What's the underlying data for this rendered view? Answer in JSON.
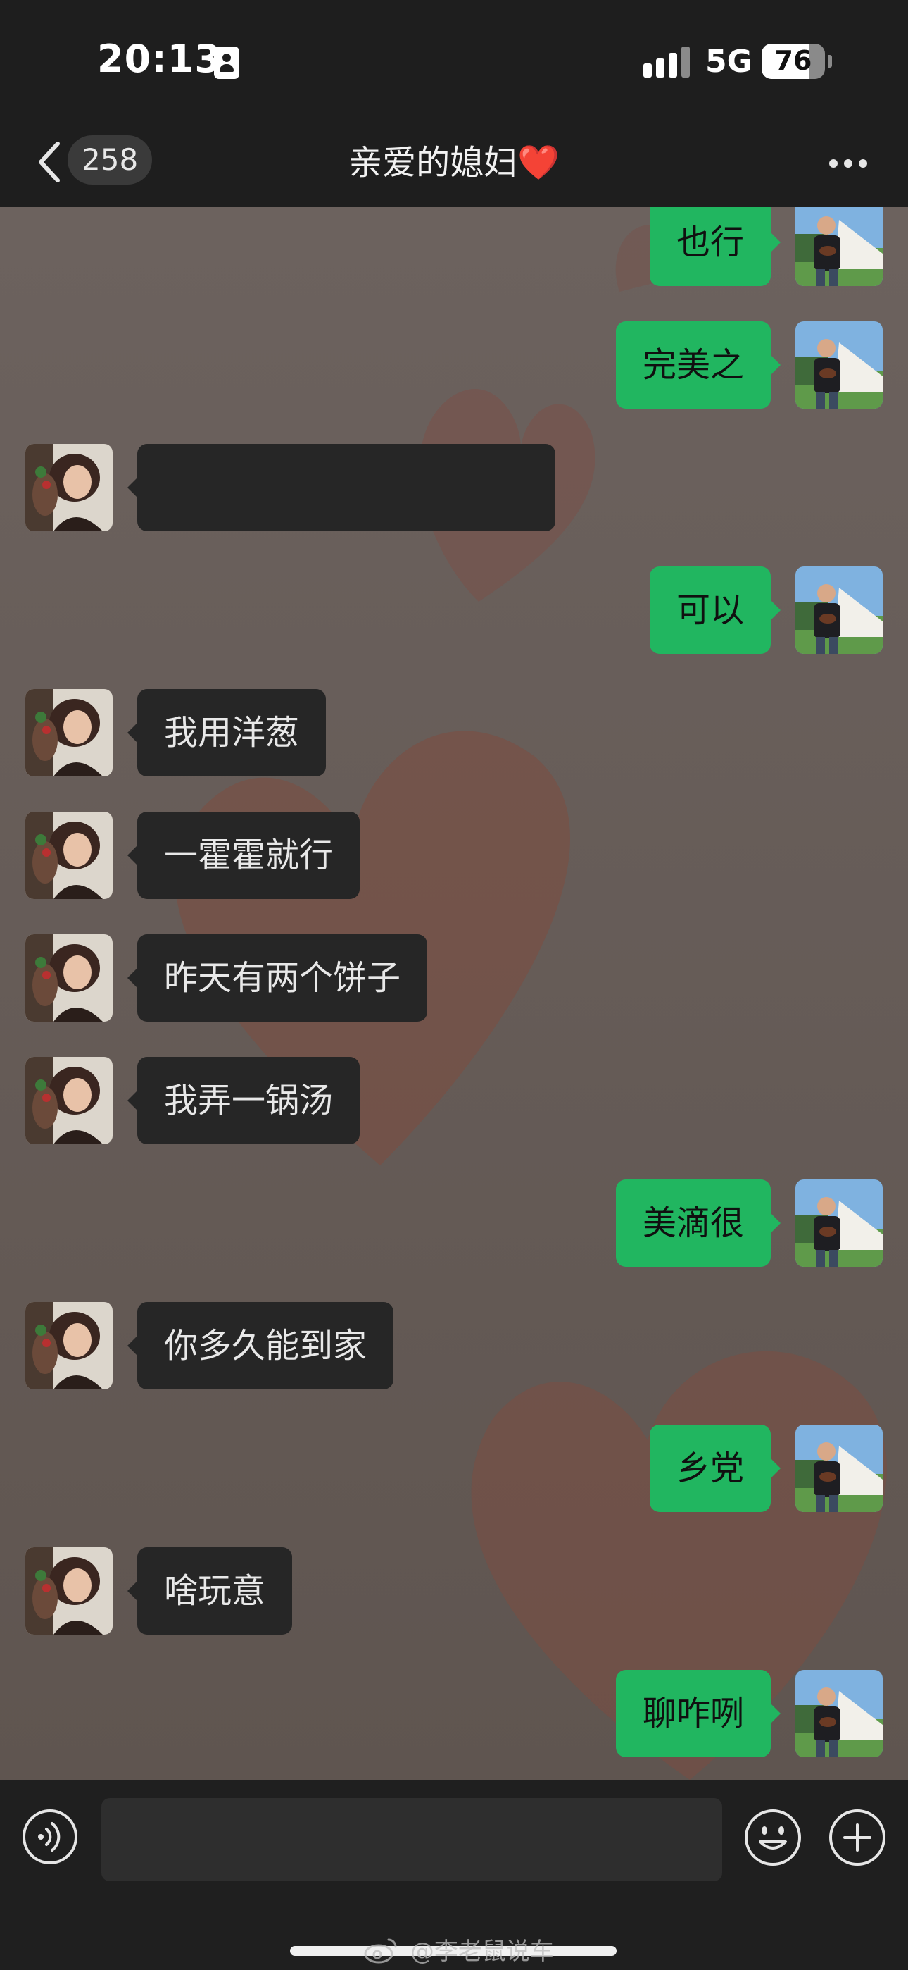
{
  "status_bar": {
    "time": "20:13",
    "network": "5G",
    "battery_level": 76,
    "battery_text": "76",
    "focus_icon": "person-badge-icon",
    "signal_icon": "cellular-signal-icon"
  },
  "nav": {
    "back_icon": "chevron-left-icon",
    "unread_count": "258",
    "title": "亲爱的媳妇❤️",
    "more_icon": "more-dots-icon"
  },
  "messages": [
    {
      "side": "right",
      "text": "也行"
    },
    {
      "side": "right",
      "text": "完美之"
    },
    {
      "side": "left",
      "text": ""
    },
    {
      "side": "right",
      "text": "可以"
    },
    {
      "side": "left",
      "text": "我用洋葱"
    },
    {
      "side": "left",
      "text": "一霍霍就行"
    },
    {
      "side": "left",
      "text": "昨天有两个饼子"
    },
    {
      "side": "left",
      "text": "我弄一锅汤"
    },
    {
      "side": "right",
      "text": "美滴很"
    },
    {
      "side": "left",
      "text": "你多久能到家"
    },
    {
      "side": "right",
      "text": "乡党"
    },
    {
      "side": "left",
      "text": "啥玩意"
    },
    {
      "side": "right",
      "text": "聊咋咧"
    }
  ],
  "input_bar": {
    "voice_icon": "voice-icon",
    "message_input_value": "",
    "emoji_icon": "emoji-icon",
    "add_icon": "plus-icon"
  },
  "watermark": {
    "text": "@李老鼠说车",
    "logo_icon": "weibo-logo-icon"
  },
  "colors": {
    "sent_bubble": "#21b660",
    "received_bubble": "#262626",
    "bar_background": "#1e1e1e",
    "chat_background": "#6a5f5b"
  }
}
